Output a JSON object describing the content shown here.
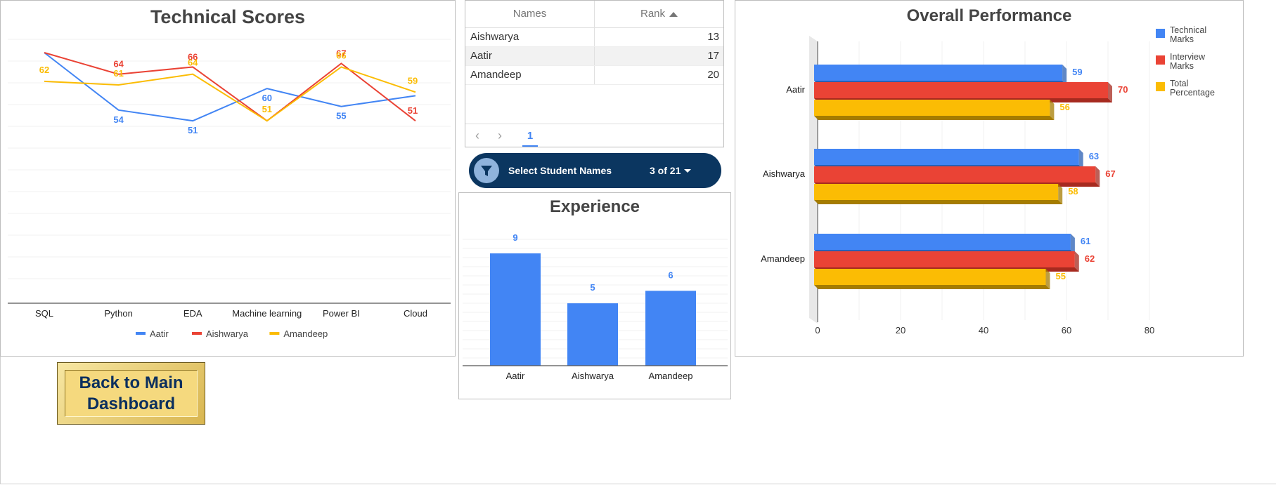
{
  "technical_scores": {
    "title": "Technical Scores",
    "chart_data": {
      "type": "line",
      "title": "Technical Scores",
      "categories": [
        "SQL",
        "Python",
        "EDA",
        "Machine learning",
        "Power BI",
        "Cloud"
      ],
      "ylim": [
        0,
        70
      ],
      "grid": true,
      "legend_position": "bottom",
      "series": [
        {
          "name": "Aatir",
          "color": "#4285f4",
          "values": [
            70,
            54,
            51,
            60,
            55,
            58
          ]
        },
        {
          "name": "Aishwarya",
          "color": "#ea4335",
          "values": [
            70,
            64,
            66,
            51,
            67,
            51
          ]
        },
        {
          "name": "Amandeep",
          "color": "#fbbc04",
          "values": [
            62,
            61,
            64,
            51,
            66,
            59
          ]
        }
      ],
      "data_labels": [
        {
          "series": "Amandeep",
          "category": "SQL",
          "text": "62"
        },
        {
          "series": "Aishwarya",
          "category": "Python",
          "text": "64"
        },
        {
          "series": "Amandeep",
          "category": "Python",
          "text": "61"
        },
        {
          "series": "Aatir",
          "category": "Python",
          "text": "54"
        },
        {
          "series": "Aishwarya",
          "category": "EDA",
          "text": "66"
        },
        {
          "series": "Amandeep",
          "category": "EDA",
          "text": "64"
        },
        {
          "series": "Aatir",
          "category": "EDA",
          "text": "51"
        },
        {
          "series": "Aatir",
          "category": "Machine learning",
          "text": "60"
        },
        {
          "series": "Amandeep",
          "category": "Machine learning",
          "text": "51"
        },
        {
          "series": "Aishwarya",
          "category": "Power BI",
          "text": "67"
        },
        {
          "series": "Amandeep",
          "category": "Power BI",
          "text": "66"
        },
        {
          "series": "Aatir",
          "category": "Power BI",
          "text": "55"
        },
        {
          "series": "Amandeep",
          "category": "Cloud",
          "text": "59"
        },
        {
          "series": "Aishwarya",
          "category": "Cloud",
          "text": "51"
        }
      ]
    }
  },
  "names_table": {
    "columns": [
      "Names",
      "Rank"
    ],
    "sort": {
      "column": "Rank",
      "direction": "ascending"
    },
    "rows": [
      {
        "name": "Aishwarya",
        "rank": "13"
      },
      {
        "name": "Aatir",
        "rank": "17"
      },
      {
        "name": "Amandeep",
        "rank": "20"
      }
    ],
    "pager": {
      "prev_icon": "chevron-left-icon",
      "next_icon": "chevron-right-icon",
      "current_page": "1"
    }
  },
  "filter_control": {
    "label": "Select Student Names",
    "count": "3 of 21",
    "icon": "filter-icon"
  },
  "experience": {
    "title": "Experience",
    "chart_data": {
      "type": "bar",
      "title": "Experience",
      "categories": [
        "Aatir",
        "Aishwarya",
        "Amandeep"
      ],
      "values": [
        9,
        5,
        6
      ],
      "color": "#4285f4",
      "ylim": [
        0,
        10
      ],
      "grid": true
    }
  },
  "overall_performance": {
    "title": "Overall Performance",
    "chart_data": {
      "type": "bar",
      "orientation": "horizontal",
      "title": "Overall Performance",
      "categories": [
        "Aatir",
        "Aishwarya",
        "Amandeep"
      ],
      "xlim": [
        0,
        80
      ],
      "x_ticks": [
        "0",
        "20",
        "40",
        "60",
        "80"
      ],
      "legend_position": "top-right",
      "series": [
        {
          "name": "Technical Marks",
          "color": "#4285f4",
          "values": [
            59,
            63,
            61
          ]
        },
        {
          "name": "Interview Marks",
          "color": "#ea4335",
          "values": [
            70,
            67,
            62
          ]
        },
        {
          "name": "Total Percentage",
          "color": "#fbbc04",
          "values": [
            56,
            58,
            55
          ]
        }
      ]
    }
  },
  "back_button": {
    "label_line1": "Back to Main",
    "label_line2": "Dashboard"
  }
}
